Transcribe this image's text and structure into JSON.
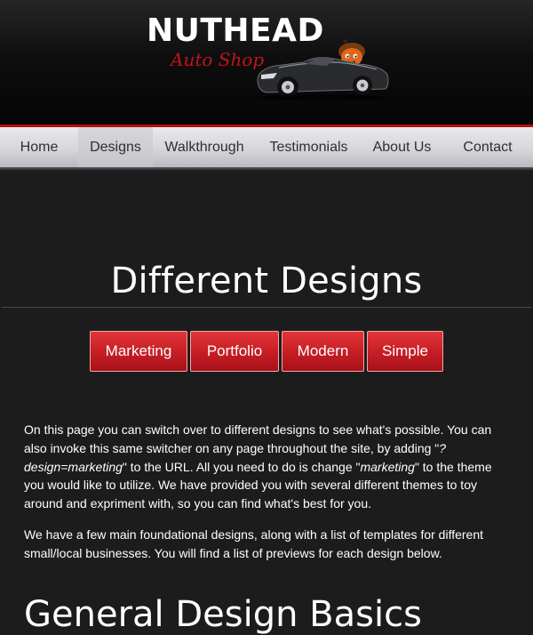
{
  "header": {
    "logo_title": "NUTHEAD",
    "logo_subtitle": "Auto Shop",
    "logo_icon": "car-with-acorn-mascot"
  },
  "nav": {
    "items": [
      {
        "label": "Home"
      },
      {
        "label": "Designs"
      },
      {
        "label": "Walkthrough"
      },
      {
        "label": "Testimonials"
      },
      {
        "label": "About Us"
      },
      {
        "label": "Contact"
      }
    ],
    "active": "Designs"
  },
  "main": {
    "title": "Different Designs",
    "design_buttons": [
      {
        "label": "Marketing"
      },
      {
        "label": "Portfolio"
      },
      {
        "label": "Modern"
      },
      {
        "label": "Simple"
      }
    ],
    "paragraph1": {
      "part1": "On this page you can switch over to different designs to see what's possible. You can also invoke this same switcher on any page throughout the site, by adding \"",
      "code": "?design=marketing",
      "part2": "\" to the URL. All you need to do is change \"",
      "keyword": "marketing",
      "part3": "\" to the theme you would like to utilize. We have provided you with several different themes to toy around and expriment with, so you can find what's best for you."
    },
    "paragraph2": "We have a few main foundational designs, along with a list of templates for different small/local businesses. You will find a list of previews for each design below.",
    "section_heading": "General Design Basics"
  },
  "colors": {
    "accent_red": "#c51d24",
    "background": "#1c1c1d",
    "nav_background": "#d7d7db"
  }
}
